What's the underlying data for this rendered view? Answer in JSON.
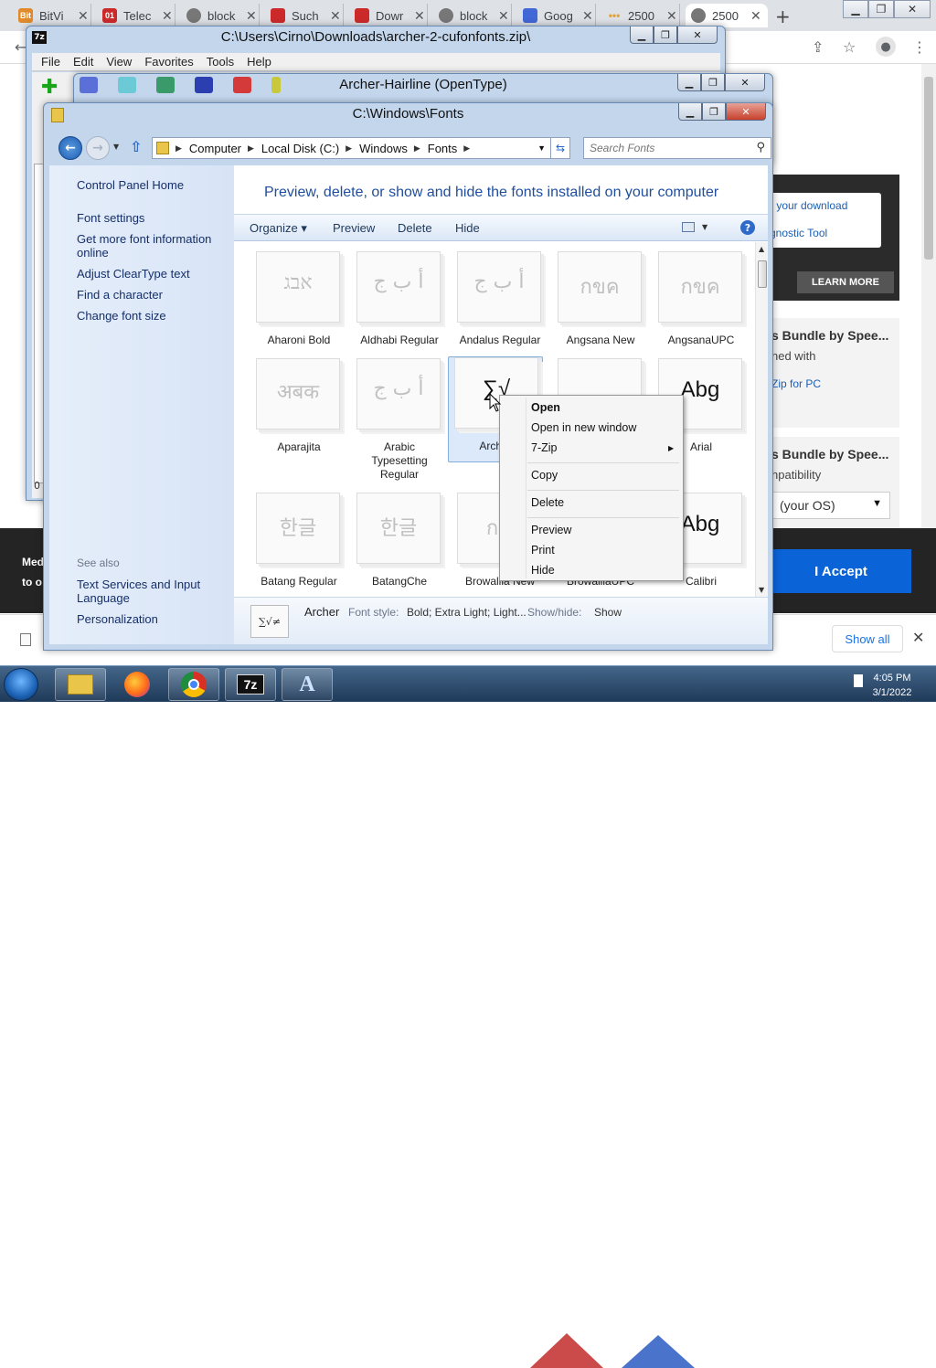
{
  "browser": {
    "tabs": [
      {
        "label": "BitVi",
        "fav_color": "#e08a2b",
        "fav_text": "Bit"
      },
      {
        "label": "Telec",
        "fav_color": "#cc2a2a",
        "fav_text": "01"
      },
      {
        "label": "block",
        "fav_color": "#777777",
        "fav_text": ""
      },
      {
        "label": "Such",
        "fav_color": "#cc2a2a",
        "fav_text": ""
      },
      {
        "label": "Dowr",
        "fav_color": "#cc2a2a",
        "fav_text": ""
      },
      {
        "label": "block",
        "fav_color": "#777777",
        "fav_text": ""
      },
      {
        "label": "Goog",
        "fav_color": "#4267d6",
        "fav_text": ""
      },
      {
        "label": "2500",
        "fav_color": "#e2a33a",
        "fav_text": ""
      },
      {
        "label": "2500",
        "fav_color": "#777777",
        "fav_text": ""
      }
    ],
    "page": {
      "promo_link_1": "r your download",
      "promo_link_2": "gnostic Tool",
      "learn_more": "LEARN MORE",
      "box1_title": "s Bundle by Spee...",
      "box1_text": "ned with",
      "box1_link": "Zip for PC",
      "box2_title": "s Bundle by Spee...",
      "box2_text": "npatibility",
      "os_select": "(your OS)",
      "cookie_line1": "Med",
      "cookie_line2": "to o",
      "accept": "I Accept",
      "show_all": "Show all"
    }
  },
  "zip_window": {
    "title": "C:\\Users\\Cirno\\Downloads\\archer-2-cufonfonts.zip\\",
    "menu": [
      "File",
      "Edit",
      "View",
      "Favorites",
      "Tools",
      "Help"
    ],
    "status": "0 A"
  },
  "archer_window": {
    "title": "Archer-Hairline (OpenType)"
  },
  "fonts_window": {
    "title": "C:\\Windows\\Fonts",
    "breadcrumb": [
      "Computer",
      "Local Disk (C:)",
      "Windows",
      "Fonts"
    ],
    "search_placeholder": "Search Fonts",
    "left_pane": {
      "home": "Control Panel Home",
      "links": [
        "Font settings",
        "Get more font information online",
        "Adjust ClearType text",
        "Find a character",
        "Change font size"
      ],
      "see_also": "See also",
      "see_also_links": [
        "Text Services and Input Language",
        "Personalization"
      ]
    },
    "headline": "Preview, delete, or show and hide the fonts installed on your computer",
    "commands": [
      "Organize ▾",
      "Preview",
      "Delete",
      "Hide"
    ],
    "fonts": [
      {
        "name": "Aharoni Bold",
        "glyph": "אבג",
        "dark": false
      },
      {
        "name": "Aldhabi Regular",
        "glyph": "أ ب ج",
        "dark": false
      },
      {
        "name": "Andalus Regular",
        "glyph": "أ ب ج",
        "dark": false
      },
      {
        "name": "Angsana New",
        "glyph": "กขค",
        "dark": false
      },
      {
        "name": "AngsanaUPC",
        "glyph": "กขค",
        "dark": false
      },
      {
        "name": "Aparajita",
        "glyph": "अबक",
        "dark": false
      },
      {
        "name": "Arabic Typesetting Regular",
        "glyph": "أ ب ج",
        "dark": false
      },
      {
        "name": "Arch",
        "glyph": "∑√",
        "dark": true
      },
      {
        "name": "",
        "glyph": "",
        "dark": false
      },
      {
        "name": "Arial",
        "glyph": "Abg",
        "dark": true
      },
      {
        "name": "Batang Regular",
        "glyph": "한글",
        "dark": false
      },
      {
        "name": "BatangChe",
        "glyph": "한글",
        "dark": false
      },
      {
        "name": "Browallia New",
        "glyph": "กข",
        "dark": false
      },
      {
        "name": "BrowalliaUPC",
        "glyph": "",
        "dark": false
      },
      {
        "name": "Calibri",
        "glyph": "Abg",
        "dark": true
      }
    ],
    "details": {
      "icon_glyph": "∑√≠",
      "name": "Archer",
      "style_label": "Font style:",
      "style_value": "Bold; Extra Light; Light...",
      "show_label": "Show/hide:",
      "show_value": "Show"
    }
  },
  "context_menu": {
    "items": [
      "Open",
      "Open in new window",
      "7-Zip",
      "Copy",
      "Delete",
      "Preview",
      "Print",
      "Hide"
    ]
  },
  "taskbar": {
    "time": "4:05 PM",
    "date": "3/1/2022",
    "apps": [
      "explorer",
      "firefox",
      "chrome",
      "7zip",
      "font-viewer"
    ]
  }
}
